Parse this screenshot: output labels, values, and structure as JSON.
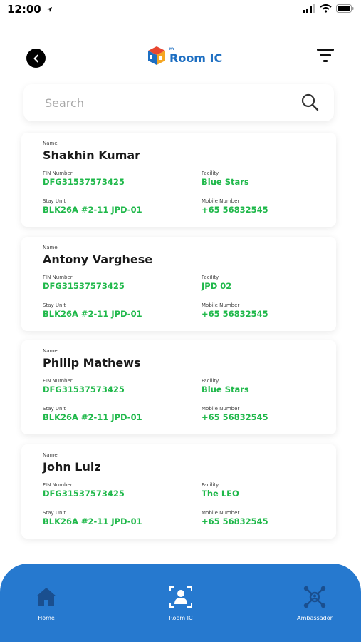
{
  "status_bar": {
    "time": "12:00",
    "icons": [
      "location-arrow-icon",
      "signal-icon",
      "wifi-icon",
      "battery-icon"
    ]
  },
  "header": {
    "back_icon": "back-arrow-icon",
    "logo_superscript": "MY",
    "app_title": "Room IC",
    "filter_icon": "filter-icon"
  },
  "search": {
    "placeholder": "Search",
    "value": "",
    "icon": "search-icon"
  },
  "labels": {
    "name": "Name",
    "fin": "FIN Number",
    "facility": "Facility",
    "stay_unit": "Stay Unit",
    "mobile": "Mobile Number"
  },
  "residents": [
    {
      "name": "Shakhin Kumar",
      "fin": "DFG31537573425",
      "facility": "Blue Stars",
      "stay_unit": "BLK26A #2-11 JPD-01",
      "mobile": "+65 56832545"
    },
    {
      "name": "Antony Varghese",
      "fin": "DFG31537573425",
      "facility": "JPD 02",
      "stay_unit": "BLK26A #2-11 JPD-01",
      "mobile": "+65 56832545"
    },
    {
      "name": "Philip Mathews",
      "fin": "DFG31537573425",
      "facility": "Blue Stars",
      "stay_unit": "BLK26A #2-11 JPD-01",
      "mobile": "+65 56832545"
    },
    {
      "name": "John Luiz",
      "fin": "DFG31537573425",
      "facility": "The LEO",
      "stay_unit": "BLK26A #2-11 JPD-01",
      "mobile": "+65 56832545"
    }
  ],
  "bottom_nav": {
    "items": [
      {
        "label": "Home",
        "icon": "home-icon"
      },
      {
        "label": "Room IC",
        "icon": "face-scan-icon"
      },
      {
        "label": "Ambassador",
        "icon": "network-icon"
      }
    ]
  },
  "colors": {
    "accent": "#2679cf",
    "value_green": "#1fb84a"
  }
}
